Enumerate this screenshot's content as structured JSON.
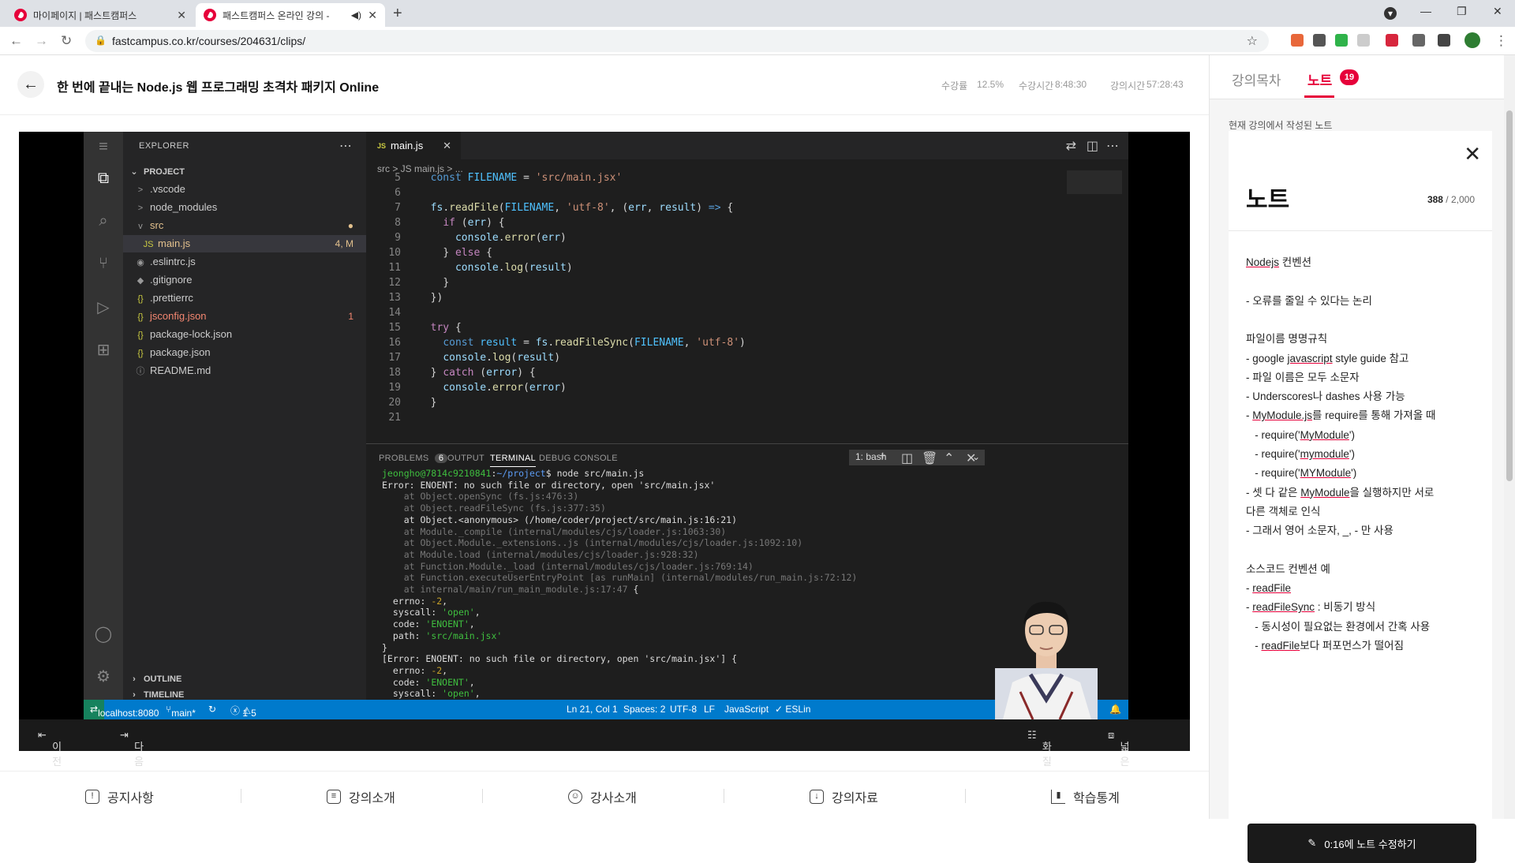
{
  "browser": {
    "tabs": [
      {
        "title": "마이페이지 | 패스트캠퍼스"
      },
      {
        "title": "패스트캠퍼스 온라인 강의 -"
      }
    ],
    "url": "fastcampus.co.kr/courses/204631/clips/"
  },
  "course": {
    "title": "한 번에 끝내는 Node.js 웹 프로그래밍 초격차 패키지 Online",
    "progress_label": "수강률",
    "progress_value": "12.5%",
    "watch_time_label": "수강시간",
    "watch_time_value": "8:48:30",
    "lecture_time_label": "강의시간",
    "lecture_time_value": "57:28:43"
  },
  "vscode": {
    "explorer_title": "EXPLORER",
    "project_label": "PROJECT",
    "files": [
      {
        "name": ".vscode",
        "icon": ">",
        "indent": 1,
        "color": "#cccccc",
        "badge": ""
      },
      {
        "name": "node_modules",
        "icon": ">",
        "indent": 1,
        "color": "#cccccc",
        "badge": ""
      },
      {
        "name": "src",
        "icon": "v",
        "indent": 1,
        "color": "#e2c08d",
        "badge": "●"
      },
      {
        "name": "main.js",
        "icon": "JS",
        "indent": 2,
        "color": "#e2c08d",
        "badge": "4, M"
      },
      {
        "name": ".eslintrc.js",
        "icon": "◉",
        "indent": 1,
        "color": "#cccccc",
        "badge": ""
      },
      {
        "name": ".gitignore",
        "icon": "◆",
        "indent": 1,
        "color": "#cccccc",
        "badge": ""
      },
      {
        "name": ".prettierrc",
        "icon": "{}",
        "indent": 1,
        "color": "#cccccc",
        "badge": ""
      },
      {
        "name": "jsconfig.json",
        "icon": "{}",
        "indent": 1,
        "color": "#f48771",
        "badge": "1"
      },
      {
        "name": "package-lock.json",
        "icon": "{}",
        "indent": 1,
        "color": "#cccccc",
        "badge": ""
      },
      {
        "name": "package.json",
        "icon": "{}",
        "indent": 1,
        "color": "#cccccc",
        "badge": ""
      },
      {
        "name": "README.md",
        "icon": "ⓘ",
        "indent": 1,
        "color": "#cccccc",
        "badge": ""
      }
    ],
    "outline_label": "OUTLINE",
    "timeline_label": "TIMELINE",
    "editor_tab": "main.js",
    "breadcrumb": "src > JS main.js > ...",
    "code_lines": [
      {
        "n": "5",
        "html": "  <span class=\"kw\">const</span> <span class=\"con\">FILENAME</span> <span class=\"pl\">=</span> <span class=\"str\">'src/main.jsx'</span>"
      },
      {
        "n": "6",
        "html": ""
      },
      {
        "n": "7",
        "html": "  <span class=\"var\">fs</span><span class=\"pl\">.</span><span class=\"fn\">readFile</span><span class=\"pl\">(</span><span class=\"con\">FILENAME</span><span class=\"pl\">, </span><span class=\"str\">'utf-8'</span><span class=\"pl\">, (</span><span class=\"var\">err</span><span class=\"pl\">, </span><span class=\"var\">result</span><span class=\"pl\">) </span><span class=\"kw\">=&gt;</span><span class=\"pl\"> {</span>"
      },
      {
        "n": "8",
        "html": "    <span class=\"kw2\">if</span><span class=\"pl\"> (</span><span class=\"var\">err</span><span class=\"pl\">) {</span>"
      },
      {
        "n": "9",
        "html": "      <span class=\"var\">console</span><span class=\"pl\">.</span><span class=\"fn\">error</span><span class=\"pl\">(</span><span class=\"var\">err</span><span class=\"pl\">)</span>"
      },
      {
        "n": "10",
        "html": "    <span class=\"pl\">} </span><span class=\"kw2\">else</span><span class=\"pl\"> {</span>"
      },
      {
        "n": "11",
        "html": "      <span class=\"var\">console</span><span class=\"pl\">.</span><span class=\"fn\">log</span><span class=\"pl\">(</span><span class=\"var\">result</span><span class=\"pl\">)</span>"
      },
      {
        "n": "12",
        "html": "    <span class=\"pl\">}</span>"
      },
      {
        "n": "13",
        "html": "  <span class=\"pl\">})</span>"
      },
      {
        "n": "14",
        "html": ""
      },
      {
        "n": "15",
        "html": "  <span class=\"kw2\">try</span><span class=\"pl\"> {</span>"
      },
      {
        "n": "16",
        "html": "    <span class=\"kw\">const</span> <span class=\"con\">result</span> <span class=\"pl\">= </span><span class=\"var\">fs</span><span class=\"pl\">.</span><span class=\"fn\">readFileSync</span><span class=\"pl\">(</span><span class=\"con\">FILENAME</span><span class=\"pl\">, </span><span class=\"str\">'utf-8'</span><span class=\"pl\">)</span>"
      },
      {
        "n": "17",
        "html": "    <span class=\"var\">console</span><span class=\"pl\">.</span><span class=\"fn\">log</span><span class=\"pl\">(</span><span class=\"var\">result</span><span class=\"pl\">)</span>"
      },
      {
        "n": "18",
        "html": "  <span class=\"pl\">} </span><span class=\"kw2\">catch</span><span class=\"pl\"> (</span><span class=\"var\">error</span><span class=\"pl\">) {</span>"
      },
      {
        "n": "19",
        "html": "    <span class=\"var\">console</span><span class=\"pl\">.</span><span class=\"fn\">error</span><span class=\"pl\">(</span><span class=\"var\">error</span><span class=\"pl\">)</span>"
      },
      {
        "n": "20",
        "html": "  <span class=\"pl\">}</span>"
      },
      {
        "n": "21",
        "html": ""
      }
    ],
    "panel_tabs": {
      "problems": "PROBLEMS",
      "problems_count": "6",
      "output": "OUTPUT",
      "terminal": "TERMINAL",
      "debug": "DEBUG CONSOLE"
    },
    "shell": "1: bash",
    "terminal_lines": [
      {
        "cls": "",
        "html": "<span class=\"grn\">jeongho@7814c9210841</span>:<span class=\"blu\">~/project</span>$ node src/main.js"
      },
      {
        "cls": "",
        "html": "Error: ENOENT: no such file or directory, open 'src/main.jsx'"
      },
      {
        "cls": "dim",
        "html": "    at Object.openSync (fs.js:476:3)"
      },
      {
        "cls": "dim",
        "html": "    at Object.readFileSync (fs.js:377:35)"
      },
      {
        "cls": "",
        "html": "    at Object.&lt;anonymous&gt; (/home/coder/project/src/main.js:16:21)"
      },
      {
        "cls": "dim",
        "html": "    at Module._compile (internal/modules/cjs/loader.js:1063:30)"
      },
      {
        "cls": "dim",
        "html": "    at Object.Module._extensions..js (internal/modules/cjs/loader.js:1092:10)"
      },
      {
        "cls": "dim",
        "html": "    at Module.load (internal/modules/cjs/loader.js:928:32)"
      },
      {
        "cls": "dim",
        "html": "    at Function.Module._load (internal/modules/cjs/loader.js:769:14)"
      },
      {
        "cls": "dim",
        "html": "    at Function.executeUserEntryPoint [as runMain] (internal/modules/run_main.js:72:12)"
      },
      {
        "cls": "dim",
        "html": "    at internal/main/run_main_module.js:17:47 <span style=\"color:#ddd\">{</span>"
      },
      {
        "cls": "",
        "html": "  errno: <span class=\"sq\">-2</span>,"
      },
      {
        "cls": "",
        "html": "  syscall: <span class=\"grn\">'open'</span>,"
      },
      {
        "cls": "",
        "html": "  code: <span class=\"grn\">'ENOENT'</span>,"
      },
      {
        "cls": "",
        "html": "  path: <span class=\"grn\">'src/main.jsx'</span>"
      },
      {
        "cls": "",
        "html": "}"
      },
      {
        "cls": "",
        "html": "[Error: ENOENT: no such file or directory, open 'src/main.jsx'] {"
      },
      {
        "cls": "",
        "html": "  errno: <span class=\"sq\">-2</span>,"
      },
      {
        "cls": "",
        "html": "  code: <span class=\"grn\">'ENOENT'</span>,"
      },
      {
        "cls": "",
        "html": "  syscall: <span class=\"grn\">'open'</span>,"
      }
    ],
    "status": {
      "remote": "localhost:8080",
      "branch": "main*",
      "errors": "1",
      "warnings": "5",
      "position": "Ln 21, Col 1",
      "spaces": "Spaces: 2",
      "encoding": "UTF-8",
      "eol": "LF",
      "language": "JavaScript",
      "eslint": "✓ ESLin"
    }
  },
  "video_controls": {
    "prev": "이전 강의",
    "next": "다음 강의",
    "quality": "화질 설정",
    "wide": "넓은 화면"
  },
  "bottom_nav": [
    "공지사항",
    "강의소개",
    "강사소개",
    "강의자료",
    "학습통계"
  ],
  "right_panel": {
    "tab_toc": "강의목차",
    "tab_note": "노트",
    "note_count": "19",
    "caption": "현재 강의에서 작성된 노트",
    "note_title": "노트",
    "char_count": "388",
    "char_limit": " / 2,000",
    "note_lines": [
      "<span class=\"ul\">Nodejs</span> 컨벤션",
      "",
      "- 오류를 줄일 수 있다는 논리",
      "",
      "파일이름 명명규칙",
      "- google <span class=\"ul\">javascript</span> style guide 참고",
      "- 파일 이름은 모두 소문자",
      "- Underscores나 dashes 사용 가능",
      "- <span class=\"ul\">MyModule.js</span>를 require를 통해 가져올 때",
      "   - require('<span class=\"ul\">MyModule</span>')",
      "   - require('<span class=\"ul\">mymodule</span>')",
      "   - require('<span class=\"ul\">MYModule</span>')",
      "- 셋 다 같은 <span class=\"ul\">MyModule</span>을 실행하지만 서로",
      "다른 객체로 인식",
      "- 그래서 영어 소문자, _, - 만 사용",
      "",
      "소스코드 컨벤션 예",
      "- <span class=\"ul\">readFile</span>",
      "- <span class=\"ul\">readFileSync</span> : 비동기 방식",
      "   - 동시성이 필요없는 환경에서 간혹 사용",
      "   - <span class=\"ul\">readFile</span>보다 퍼포먼스가 떨어짐"
    ],
    "edit_button": "0:16에 노트 수정하기"
  }
}
